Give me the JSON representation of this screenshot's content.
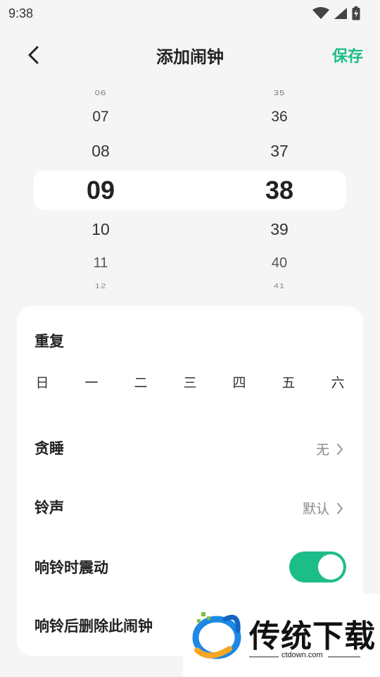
{
  "status_bar": {
    "time": "9:38",
    "icons": [
      "wifi-icon",
      "cellular-signal-icon",
      "battery-charging-icon"
    ]
  },
  "header": {
    "title": "添加闹钟",
    "save_label": "保存",
    "back_icon": "chevron-left-icon"
  },
  "time_picker": {
    "hours": [
      "06",
      "07",
      "08",
      "09",
      "10",
      "11",
      "12"
    ],
    "minutes": [
      "35",
      "36",
      "37",
      "38",
      "39",
      "40",
      "41"
    ],
    "selected_hour": "09",
    "selected_minute": "38"
  },
  "settings": {
    "repeat": {
      "label": "重复",
      "days": [
        "日",
        "一",
        "二",
        "三",
        "四",
        "五",
        "六"
      ]
    },
    "snooze": {
      "label": "贪睡",
      "value": "无"
    },
    "ringtone": {
      "label": "铃声",
      "value": "默认"
    },
    "vibrate": {
      "label": "响铃时震动",
      "enabled": true
    },
    "delete_after": {
      "label": "响铃后删除此闹钟"
    }
  },
  "watermark": {
    "brand": "传统下载",
    "site": "ctdown.com"
  },
  "colors": {
    "accent": "#1dbd89",
    "background": "#f5f5f5",
    "card": "#ffffff"
  }
}
